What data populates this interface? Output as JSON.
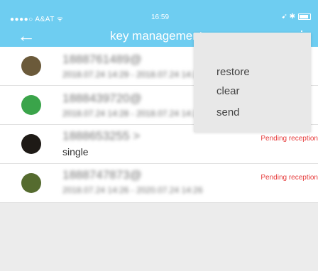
{
  "status_bar": {
    "carrier": "●●●●○ A&AT ᯤ",
    "time": "16:59",
    "right_icons": "➹ ✱"
  },
  "header": {
    "back_icon": "←",
    "title": "key management",
    "more_icon": "⋮"
  },
  "popup_menu": {
    "items": [
      "restore",
      "clear",
      "send"
    ]
  },
  "keys": [
    {
      "phone": "1888761489",
      "suffix": "@",
      "date": "2018.07.24 14:29 - 2018.07.24 14:29",
      "pending": "",
      "avatar_color": "#6b5a3a"
    },
    {
      "phone": "1888439720",
      "suffix": "@",
      "date": "2018.07.24 14:28 - 2018.07.24 14:28",
      "pending": "",
      "avatar_color": "#3aa44a"
    },
    {
      "phone": "1888653255",
      "suffix": ">",
      "date": "single",
      "pending": "Pending reception",
      "avatar_color": "#1e1a16"
    },
    {
      "phone": "1888747873",
      "suffix": "@",
      "date": "2018.07.24 14:26 - 2020.07.24 14:26",
      "pending": "Pending reception",
      "avatar_color": "#556b2f"
    }
  ]
}
